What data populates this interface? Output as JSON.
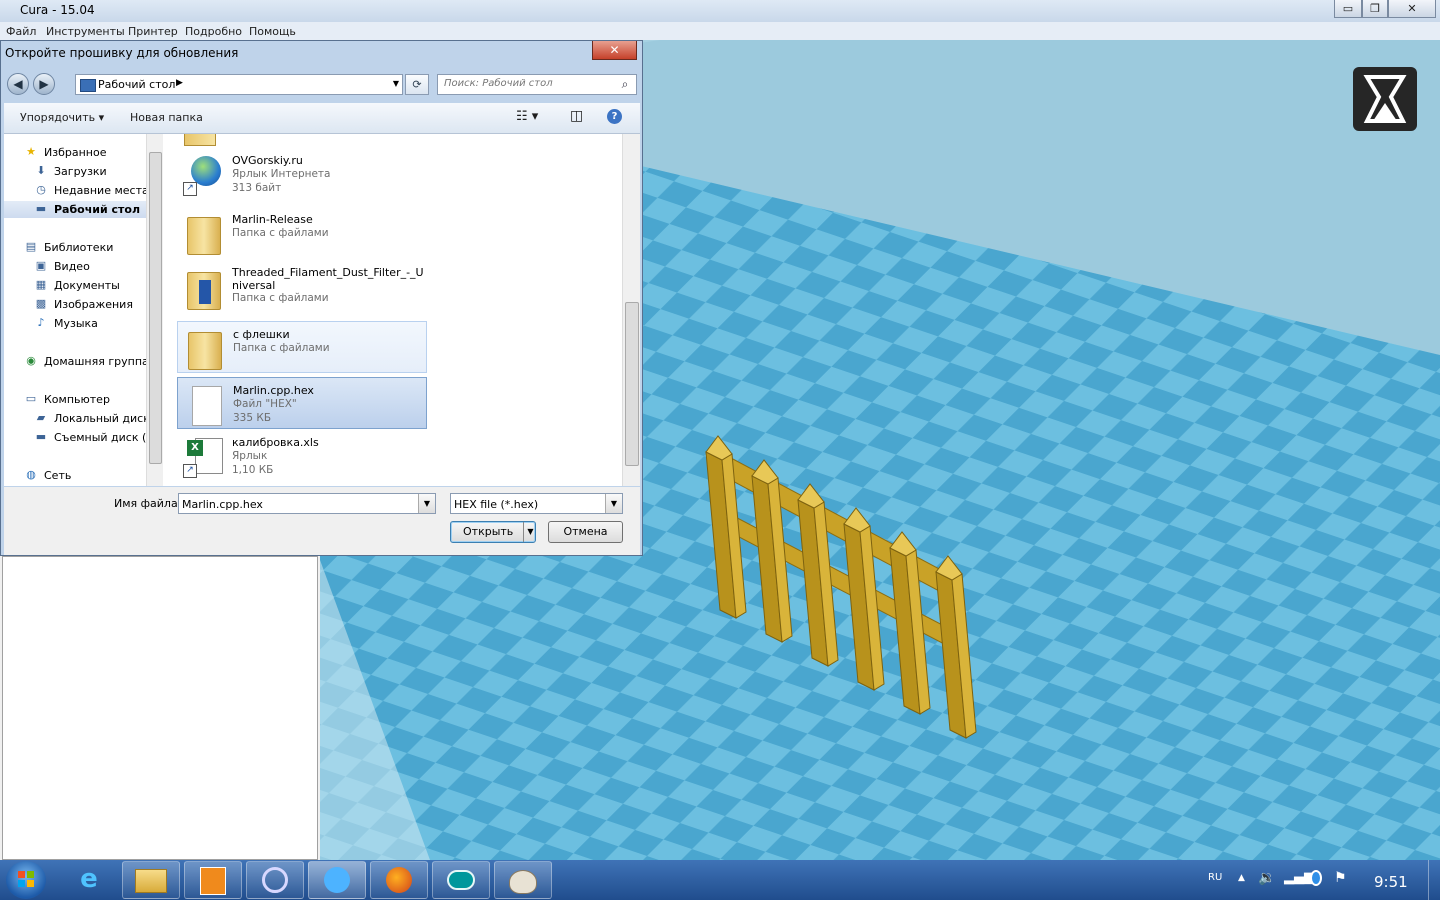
{
  "window": {
    "title": "Cura - 15.04"
  },
  "window_controls": {
    "minimize": "▭",
    "maximize": "❐",
    "close": "✕"
  },
  "menu": [
    "Файл",
    "Инструменты",
    "Принтер",
    "Подробно",
    "Помощь"
  ],
  "dialog": {
    "title": "Откройте прошивку для обновления",
    "close_label": "✕",
    "address": "Рабочий стол",
    "search_placeholder": "Поиск: Рабочий стол",
    "toolbar": {
      "organize": "Упорядочить",
      "new_folder": "Новая папка"
    },
    "nav": [
      {
        "label": "Избранное",
        "icon": "star-icon",
        "level": 0
      },
      {
        "label": "Загрузки",
        "icon": "downloads-icon",
        "level": 1
      },
      {
        "label": "Недавние места",
        "icon": "recent-places-icon",
        "level": 1
      },
      {
        "label": "Рабочий стол",
        "icon": "desktop-icon",
        "level": 1,
        "selected": true
      },
      {
        "label": "Библиотеки",
        "icon": "libraries-icon",
        "level": 0
      },
      {
        "label": "Видео",
        "icon": "video-icon",
        "level": 1
      },
      {
        "label": "Документы",
        "icon": "documents-icon",
        "level": 1
      },
      {
        "label": "Изображения",
        "icon": "pictures-icon",
        "level": 1
      },
      {
        "label": "Музыка",
        "icon": "music-icon",
        "level": 1
      },
      {
        "label": "Домашняя группа",
        "icon": "homegroup-icon",
        "level": 0
      },
      {
        "label": "Компьютер",
        "icon": "computer-icon",
        "level": 0
      },
      {
        "label": "Локальный диск (",
        "icon": "local-disk-icon",
        "level": 1
      },
      {
        "label": "Съемный диск (E:",
        "icon": "removable-disk-icon",
        "level": 1
      },
      {
        "label": "Сеть",
        "icon": "network-icon",
        "level": 0
      }
    ],
    "files": [
      {
        "name": "OVGorskiy.ru",
        "type": "Ярлык Интернета",
        "size": "313 байт",
        "icon": "internet-shortcut-icon",
        "state": ""
      },
      {
        "name": "Marlin-Release",
        "type": "Папка с файлами",
        "size": "",
        "icon": "folder-icon",
        "state": ""
      },
      {
        "name": "Threaded_Filament_Dust_Filter_-_Universal",
        "type": "Папка с файлами",
        "size": "",
        "icon": "folder-icon",
        "state": ""
      },
      {
        "name": "с флешки",
        "type": "Папка с файлами",
        "size": "",
        "icon": "folder-icon",
        "state": "hover"
      },
      {
        "name": "Marlin.cpp.hex",
        "type": "Файл \"HEX\"",
        "size": "335 КБ",
        "icon": "file-icon",
        "state": "selected"
      },
      {
        "name": "калибровка.xls",
        "type": "Ярлык",
        "size": "1,10 КБ",
        "icon": "excel-shortcut-icon",
        "state": ""
      }
    ],
    "filename_label": "Имя файла:",
    "filename_value": "Marlin.cpp.hex",
    "filetype_value": "HEX file (*.hex)",
    "open_button": "Открыть",
    "cancel_button": "Отмена"
  },
  "taskbar": {
    "apps": [
      "start-icon",
      "internet-explorer-icon",
      "file-explorer-icon",
      "media-player-icon",
      "app-icon",
      "cura-icon",
      "firefox-icon",
      "arduino-icon",
      "paint-icon"
    ],
    "language": "RU",
    "clock": "9:51"
  },
  "colors": {
    "viewport_blue": "#5fb4d8",
    "model_gold": "#c9a227",
    "dialog_frame": "#bfd3ea"
  }
}
